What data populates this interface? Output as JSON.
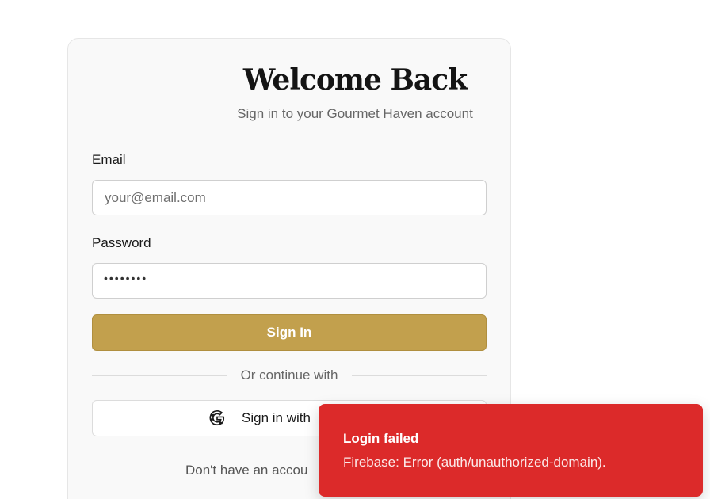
{
  "login": {
    "title": "Welcome Back",
    "subtitle": "Sign in to your Gourmet Haven account",
    "email_label": "Email",
    "email_placeholder": "your@email.com",
    "email_value": "",
    "password_label": "Password",
    "password_masked": "••••••••",
    "sign_in_label": "Sign In",
    "divider_text": "Or continue with",
    "google_label": "Sign in with",
    "signup_prompt": "Don't have an accou"
  },
  "toast": {
    "title": "Login failed",
    "message": "Firebase: Error (auth/unauthorized-domain)."
  },
  "colors": {
    "accent": "#c2a04d",
    "error": "#dc2a2a",
    "card_bg": "#f9f9f9"
  },
  "icons": {
    "google": "google-g-icon"
  }
}
